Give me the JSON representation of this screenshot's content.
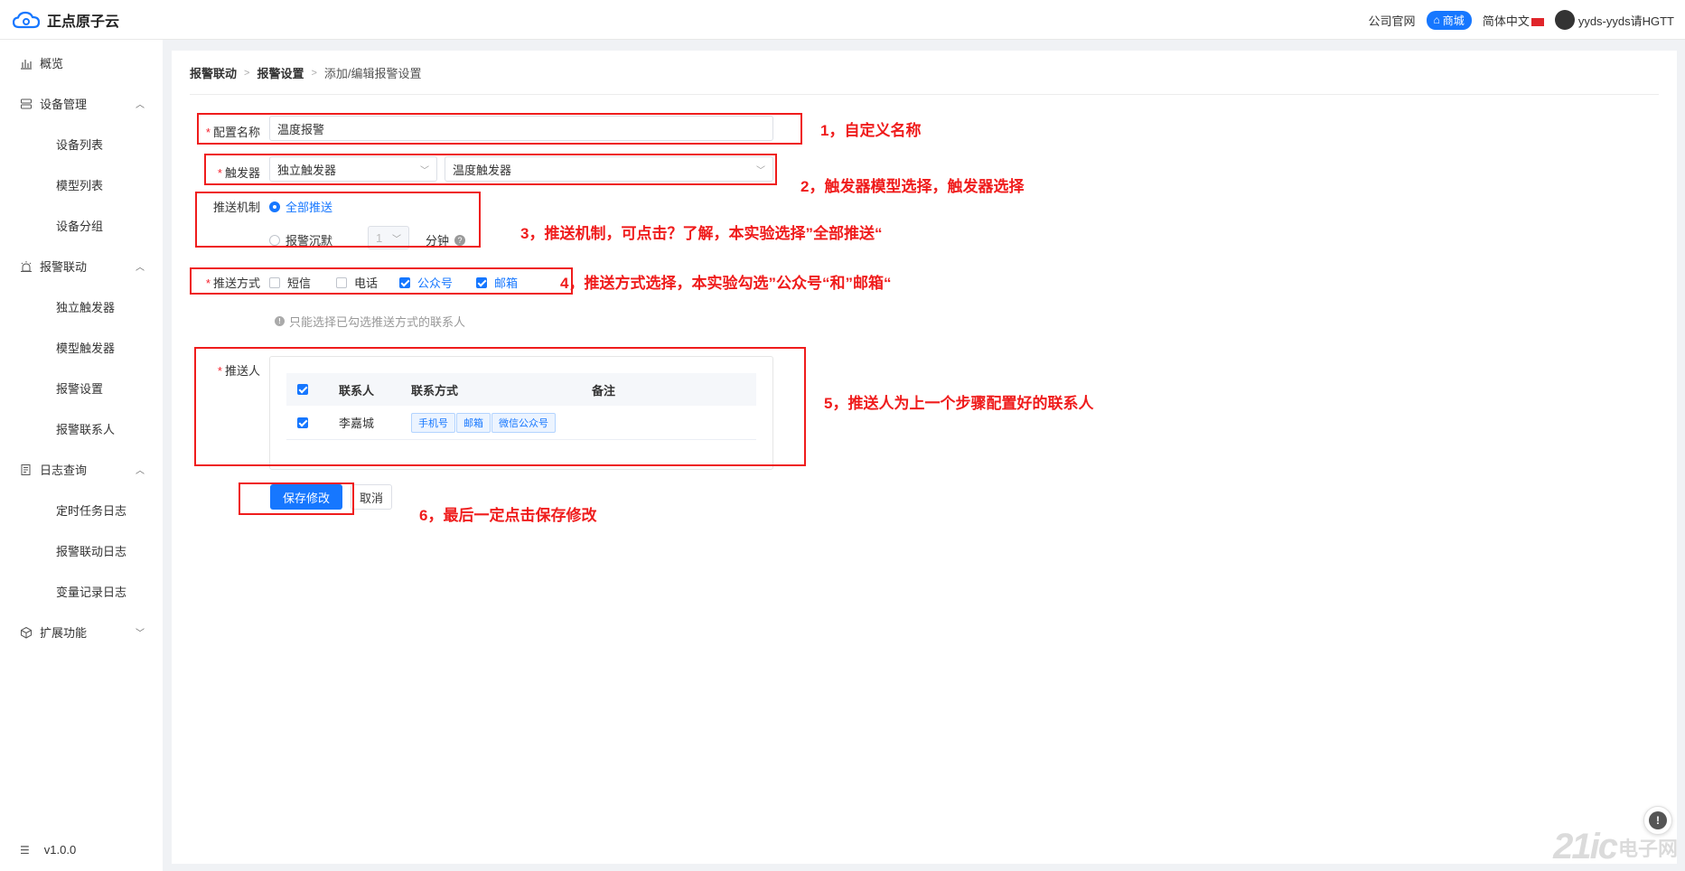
{
  "header": {
    "logo_text": "正点原子云",
    "links": {
      "official": "公司官网",
      "shop": "商城",
      "language": "简体中文",
      "user": "yyds-yyds请HGTT"
    }
  },
  "sidebar": {
    "items": [
      {
        "label": "概览",
        "type": "group"
      },
      {
        "label": "设备管理",
        "type": "group",
        "expanded": true,
        "children": [
          "设备列表",
          "模型列表",
          "设备分组"
        ]
      },
      {
        "label": "报警联动",
        "type": "group",
        "expanded": true,
        "children": [
          "独立触发器",
          "模型触发器",
          "报警设置",
          "报警联系人"
        ]
      },
      {
        "label": "日志查询",
        "type": "group",
        "expanded": true,
        "children": [
          "定时任务日志",
          "报警联动日志",
          "变量记录日志"
        ]
      },
      {
        "label": "扩展功能",
        "type": "group",
        "expanded": false
      }
    ],
    "version": "v1.0.0"
  },
  "breadcrumb": {
    "level1": "报警联动",
    "level2": "报警设置",
    "current": "添加/编辑报警设置"
  },
  "form": {
    "name_label": "配置名称",
    "name_value": "温度报警",
    "trigger_label": "触发器",
    "trigger_type_value": "独立触发器",
    "trigger_value": "温度触发器",
    "push_mechanism_label": "推送机制",
    "push_all_label": "全部推送",
    "push_silence_label": "报警沉默",
    "silence_value": "1",
    "silence_unit": "分钟",
    "push_method_label": "推送方式",
    "methods": [
      {
        "label": "短信",
        "checked": false
      },
      {
        "label": "电话",
        "checked": false
      },
      {
        "label": "公众号",
        "checked": true
      },
      {
        "label": "邮箱",
        "checked": true
      }
    ],
    "hint": "只能选择已勾选推送方式的联系人",
    "recipients_label": "推送人",
    "table": {
      "headers": {
        "contact": "联系人",
        "method": "联系方式",
        "note": "备注"
      },
      "rows": [
        {
          "contact": "李嘉城",
          "tags": [
            "手机号",
            "邮箱",
            "微信公众号"
          ],
          "note": "",
          "checked": true
        }
      ]
    },
    "save_label": "保存修改",
    "cancel_label": "取消"
  },
  "annotations": {
    "a1": "1，自定义名称",
    "a2": "2，触发器模型选择，触发器选择",
    "a3": "3，推送机制，可点击？了解，本实验选择”全部推送“",
    "a4": "4，推送方式选择，本实验勾选”公众号“和”邮箱“",
    "a5": "5，推送人为上一个步骤配置好的联系人",
    "a6": "6，最后一定点击保存修改"
  },
  "watermark": {
    "logo": "21ic",
    "text": "电子网"
  },
  "colors": {
    "primary": "#1677ff",
    "annotation": "#ef1c1c"
  }
}
